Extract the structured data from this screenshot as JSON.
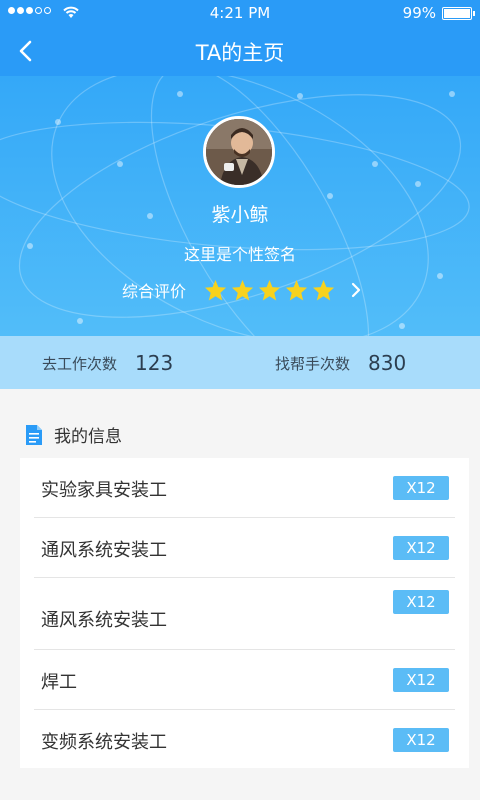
{
  "status_bar": {
    "time": "4:21 PM",
    "battery": "99%"
  },
  "header": {
    "title": "TA的主页"
  },
  "profile": {
    "name": "紫小鲸",
    "signature": "这里是个性签名",
    "rating_label": "综合评价",
    "rating_stars": 5,
    "rating_max": 5,
    "star_color": "#f7d21e"
  },
  "stats": {
    "work": {
      "label": "去工作次数",
      "value": "123"
    },
    "help": {
      "label": "找帮手次数",
      "value": "830"
    }
  },
  "section": {
    "title": "我的信息"
  },
  "info_items": [
    {
      "label": "实验家具安装工",
      "badge": "X12"
    },
    {
      "label": "通风系统安装工",
      "badge": "X12"
    },
    {
      "label": "通风系统安装工",
      "badge": "X12"
    },
    {
      "label": "焊工",
      "badge": "X12"
    },
    {
      "label": "变频系统安装工",
      "badge": "X12"
    }
  ],
  "colors": {
    "primary": "#2a9bf7",
    "badge": "#5bbcf6",
    "stats_bg": "#a8dcfb"
  }
}
